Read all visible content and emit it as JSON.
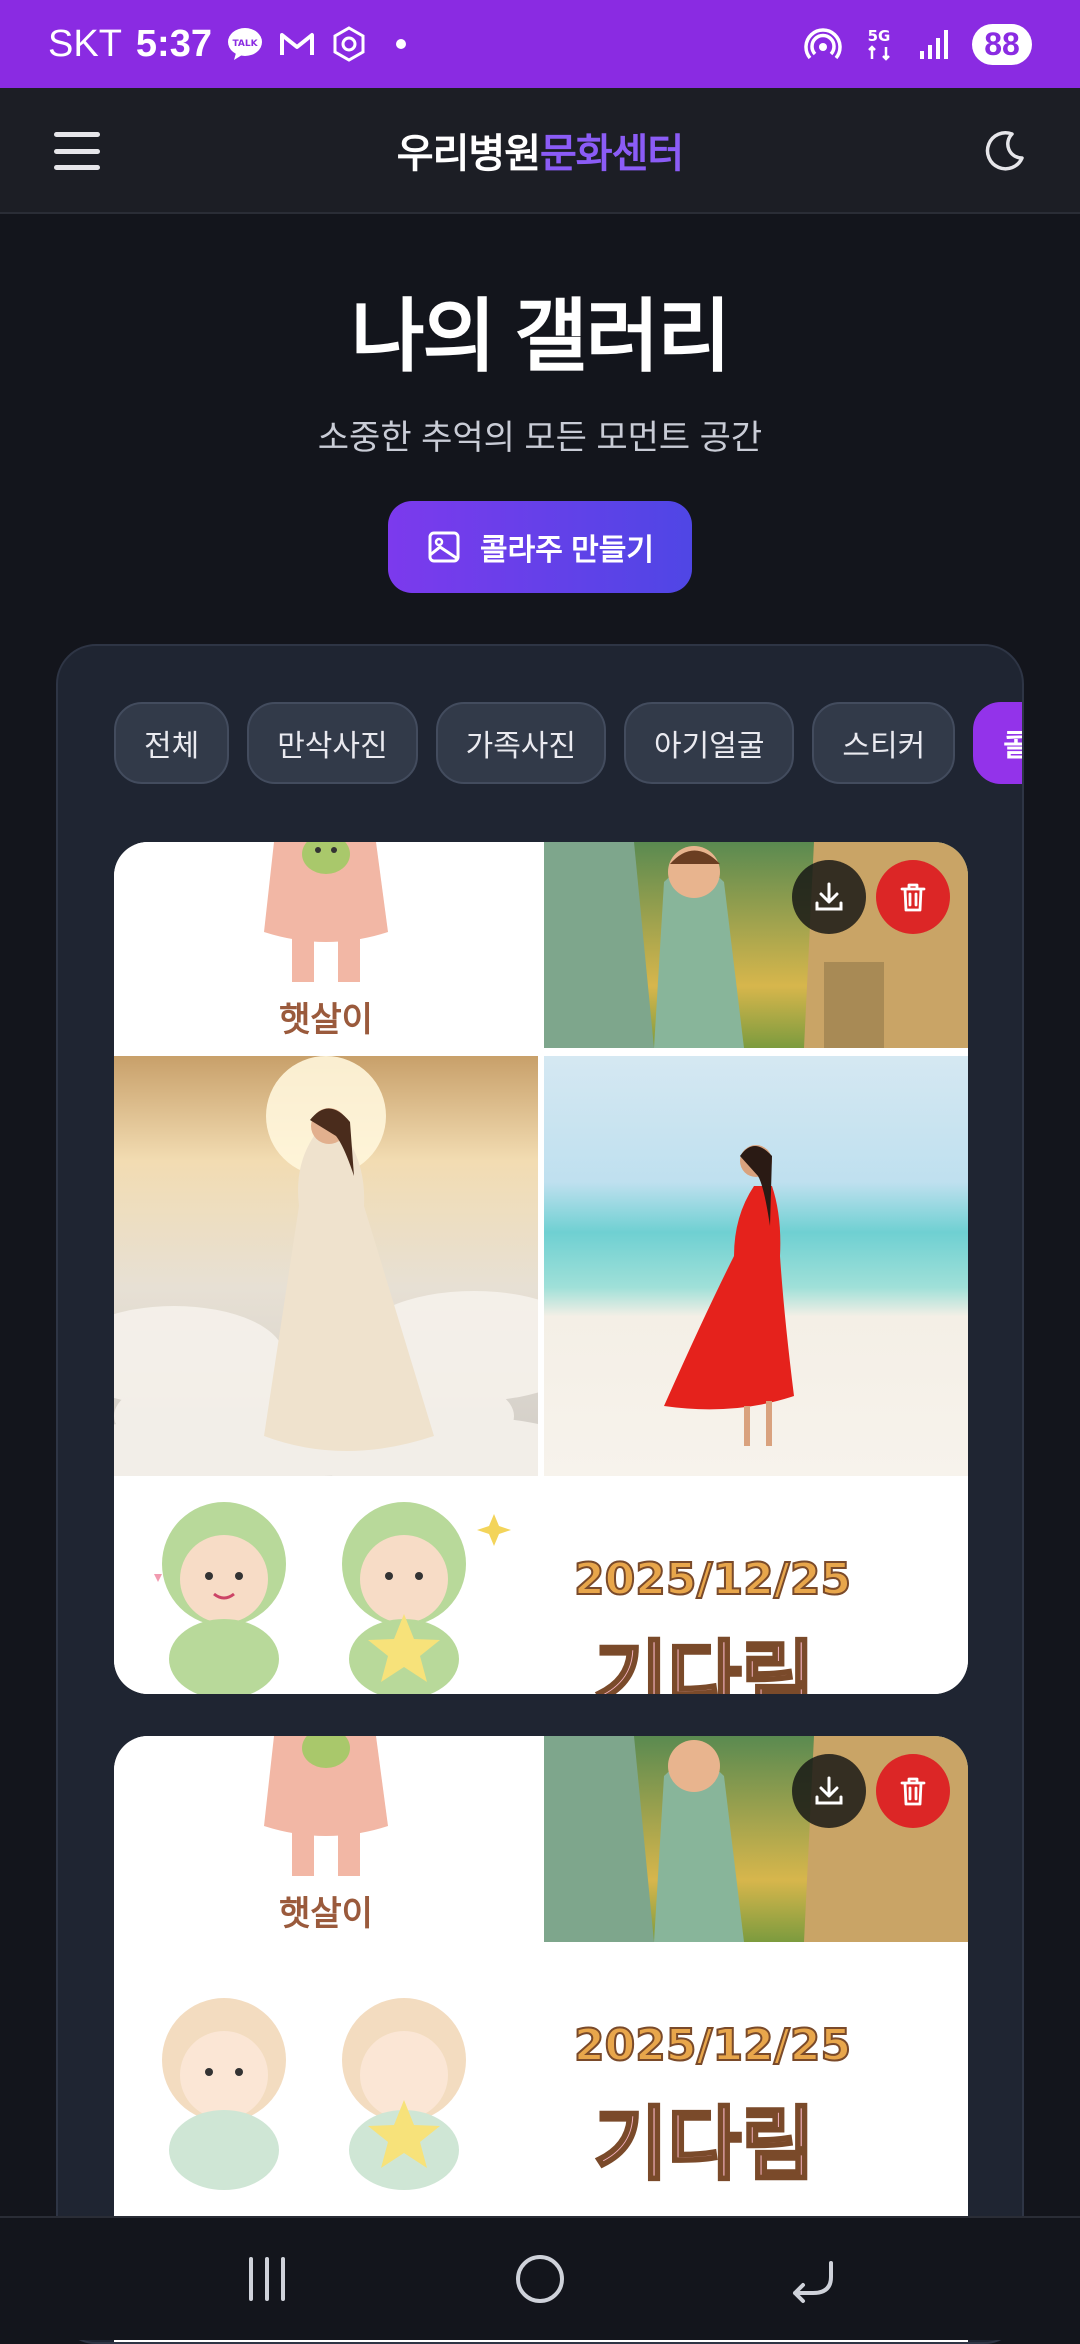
{
  "status_bar": {
    "carrier": "SKT",
    "time": "5:37",
    "notifications": [
      "talk-icon",
      "gmail-icon",
      "shield-app-icon",
      "dot"
    ],
    "network": "5G",
    "battery": "88"
  },
  "header": {
    "brand_part1": "우리병원",
    "brand_part2": "문화센터",
    "menu_icon": "hamburger-icon",
    "theme_icon": "moon-icon"
  },
  "hero": {
    "title": "나의 갤러리",
    "subtitle": "소중한 추억의 모든 모먼트 공간",
    "collage_button": "콜라주 만들기"
  },
  "filters": [
    {
      "label": "전체",
      "active": false
    },
    {
      "label": "만삭사진",
      "active": false
    },
    {
      "label": "가족사진",
      "active": false
    },
    {
      "label": "아기얼굴",
      "active": false
    },
    {
      "label": "스티커",
      "active": false
    },
    {
      "label": "콜라주",
      "active": true
    }
  ],
  "photos": [
    {
      "type": "collage",
      "sticker_caption": "햇살이",
      "date_text": "2025/12/25",
      "sticker_word": "기다림"
    },
    {
      "type": "collage",
      "sticker_caption": "햇살이",
      "date_text": "2025/12/25",
      "sticker_word": "기다림"
    }
  ],
  "colors": {
    "status_bar": "#8a2be2",
    "accent": "#9333ea",
    "background": "#13151c",
    "card": "#1f2532",
    "delete": "#dc2626"
  }
}
